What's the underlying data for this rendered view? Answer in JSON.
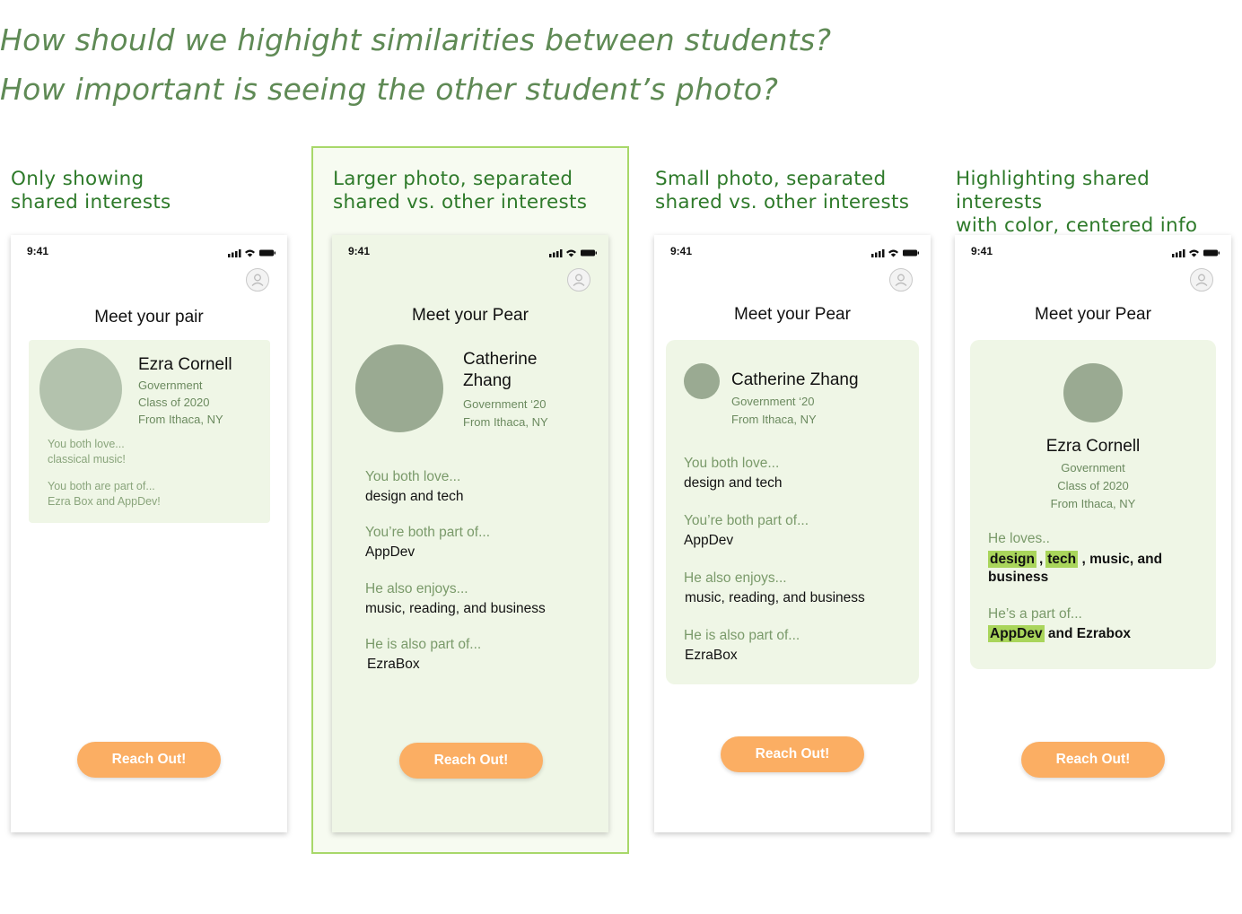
{
  "questions": {
    "q1": "How should we highight similarities between students?",
    "q2": "How important is seeing the other student’s photo?"
  },
  "colors": {
    "accent_green": "#a8d86a",
    "button_orange": "#fbae63",
    "card_bg": "#eff6e6",
    "heading_green": "#2e7a2a"
  },
  "options": [
    {
      "caption_line1": "Only showing",
      "caption_line2": "shared interests"
    },
    {
      "caption_line1": "Larger photo, separated",
      "caption_line2": "shared vs. other interests"
    },
    {
      "caption_line1": "Small photo, separated",
      "caption_line2": "shared vs. other interests"
    },
    {
      "caption_line1": "Highlighting shared interests",
      "caption_line2": "with color, centered info"
    }
  ],
  "phone1": {
    "time": "9:41",
    "title": "Meet your pair",
    "name": "Ezra Cornell",
    "info1": "Government",
    "info2": "Class of 2020",
    "info3": "From Ithaca, NY",
    "label1": "You both love...",
    "value1": "classical music!",
    "label2": "You both are part of...",
    "value2": "Ezra Box and AppDev!",
    "button": "Reach Out!"
  },
  "phone2": {
    "time": "9:41",
    "title": "Meet your Pear",
    "name_line1": "Catherine",
    "name_line2": "Zhang",
    "info1": "Government ‘20",
    "info2": "From Ithaca, NY",
    "label1": "You both love...",
    "value1": "design and tech",
    "label2": "You’re both part of...",
    "value2": "AppDev",
    "label3": "He also enjoys...",
    "value3": "music, reading, and business",
    "label4": "He is also part of...",
    "value4": "EzraBox",
    "button": "Reach Out!"
  },
  "phone3": {
    "time": "9:41",
    "title": "Meet your Pear",
    "name": "Catherine Zhang",
    "info1": "Government ‘20",
    "info2": "From Ithaca, NY",
    "label1": "You both love...",
    "value1": "design and tech",
    "label2": "You’re both part of...",
    "value2": "AppDev",
    "label3": "He also enjoys...",
    "value3": "music, reading, and business",
    "label4": "He is also part of...",
    "value4": "EzraBox",
    "button": "Reach Out!"
  },
  "phone4": {
    "time": "9:41",
    "title": "Meet your Pear",
    "name": "Ezra Cornell",
    "info1": "Government",
    "info2": "Class of 2020",
    "info3": "From Ithaca, NY",
    "label1": "He loves..",
    "chip1": "design",
    "sep1": ",",
    "chip2": "tech",
    "rest1": ", music, and",
    "rest1b": "business",
    "label2": "He’s a part of...",
    "chip3": "AppDev",
    "rest2": "and Ezrabox",
    "button": "Reach Out!"
  }
}
